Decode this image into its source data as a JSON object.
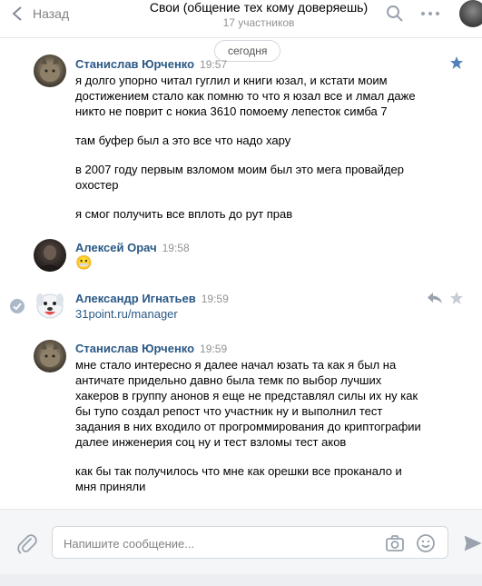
{
  "header": {
    "back_label": "Назад",
    "title": "Свои (общение тех кому доверяешь)",
    "subtitle": "17 участников"
  },
  "date_separator": "сегодня",
  "messages": [
    {
      "author": "Станислав Юрченко",
      "time": "19:57",
      "paragraphs": [
        "я долго упорно читал гуглил и книги юзал, и кстати моим\nдостижением стало как помню то что я юзал все и лмал даже\nникто не поврит с нокиа 3610 помоему лепесток симба 7",
        "там буфер был а это все что надо хару",
        "в 2007 году первым взломом моим был это мега провайдер\nохостер",
        "я смог получить все вплоть до рут прав"
      ]
    },
    {
      "author": "Алексей Орач",
      "time": "19:58",
      "emoji": "😬"
    },
    {
      "author": "Александр Игнатьев",
      "time": "19:59",
      "link": "31point.ru/manager"
    },
    {
      "author": "Станислав Юрченко",
      "time": "19:59",
      "paragraphs": [
        "мне стало интересно я далее начал юзать та как я был на\nантичате придельно давно была темк по выбор лучших\nхакеров в группу анонов я еще не представлял силы их ну как\nбы тупо создал репост что участник ну и выполнил тест\nзадания в них входило от прогроммирования до криптографии\nдалее инженерия соц ну и тест взломы тест аков",
        "как бы так получилось что мне как орешки все проканало и\nмня приняли"
      ]
    }
  ],
  "composer": {
    "placeholder": "Напишите сообщение..."
  },
  "colors": {
    "link": "#2a5885",
    "muted": "#939393",
    "star": "#5181b8",
    "icon": "#99a2ad"
  }
}
